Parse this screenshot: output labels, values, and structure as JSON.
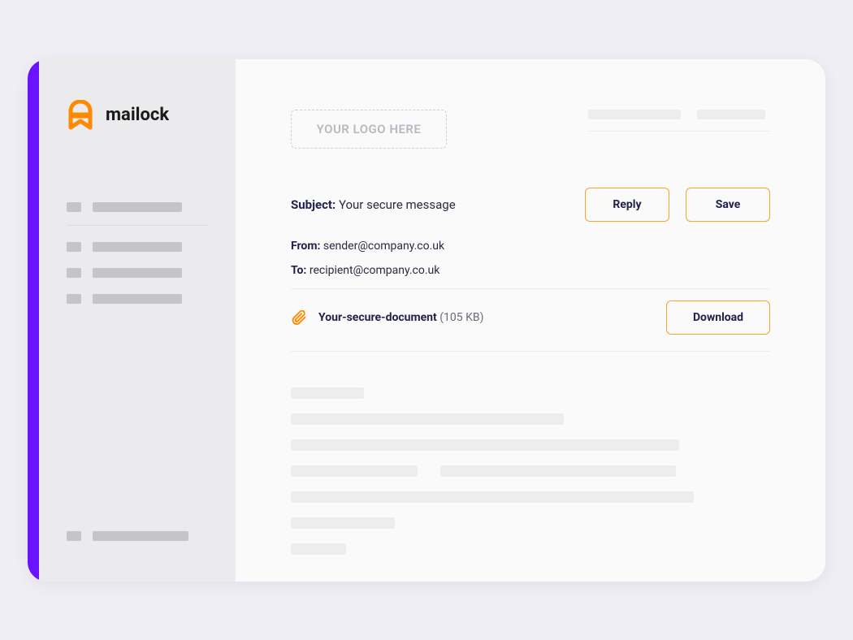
{
  "brand": {
    "logo_text": "mailock",
    "accent_color": "#6a13ff",
    "icon_color": "#ff8a00"
  },
  "header": {
    "logo_placeholder_text": "YOUR LOGO HERE"
  },
  "email": {
    "subject_label": "Subject:",
    "subject_value": "Your secure message",
    "from_label": "From:",
    "from_value": "sender@company.co.uk",
    "to_label": "To:",
    "to_value": "recipient@company.co.uk"
  },
  "actions": {
    "reply_label": "Reply",
    "save_label": "Save",
    "download_label": "Download"
  },
  "attachment": {
    "file_name": "Your-secure-document",
    "file_size": "(105 KB)"
  }
}
